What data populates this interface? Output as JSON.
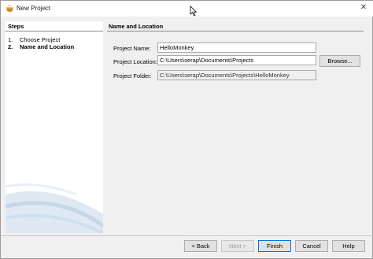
{
  "window": {
    "title": "New Project",
    "close_glyph": "✕"
  },
  "steps": {
    "title": "Steps",
    "items": [
      {
        "num": "1.",
        "label": "Choose Project"
      },
      {
        "num": "2.",
        "label": "Name and Location"
      }
    ]
  },
  "content": {
    "title": "Name and Location",
    "project_name": {
      "label": "Project Name:",
      "value": "HelloMonkey"
    },
    "project_location": {
      "label": "Project Location:",
      "value": "C:\\Users\\serap\\Documents\\Projects"
    },
    "project_folder": {
      "label": "Project Folder:",
      "value": "C:\\Users\\serap\\Documents\\Projects\\HelloMonkey"
    },
    "browse_label": "Browse..."
  },
  "footer": {
    "back_label": "< Back",
    "next_label": "Next >",
    "finish_label": "Finish",
    "cancel_label": "Cancel",
    "help_label": "Help"
  }
}
